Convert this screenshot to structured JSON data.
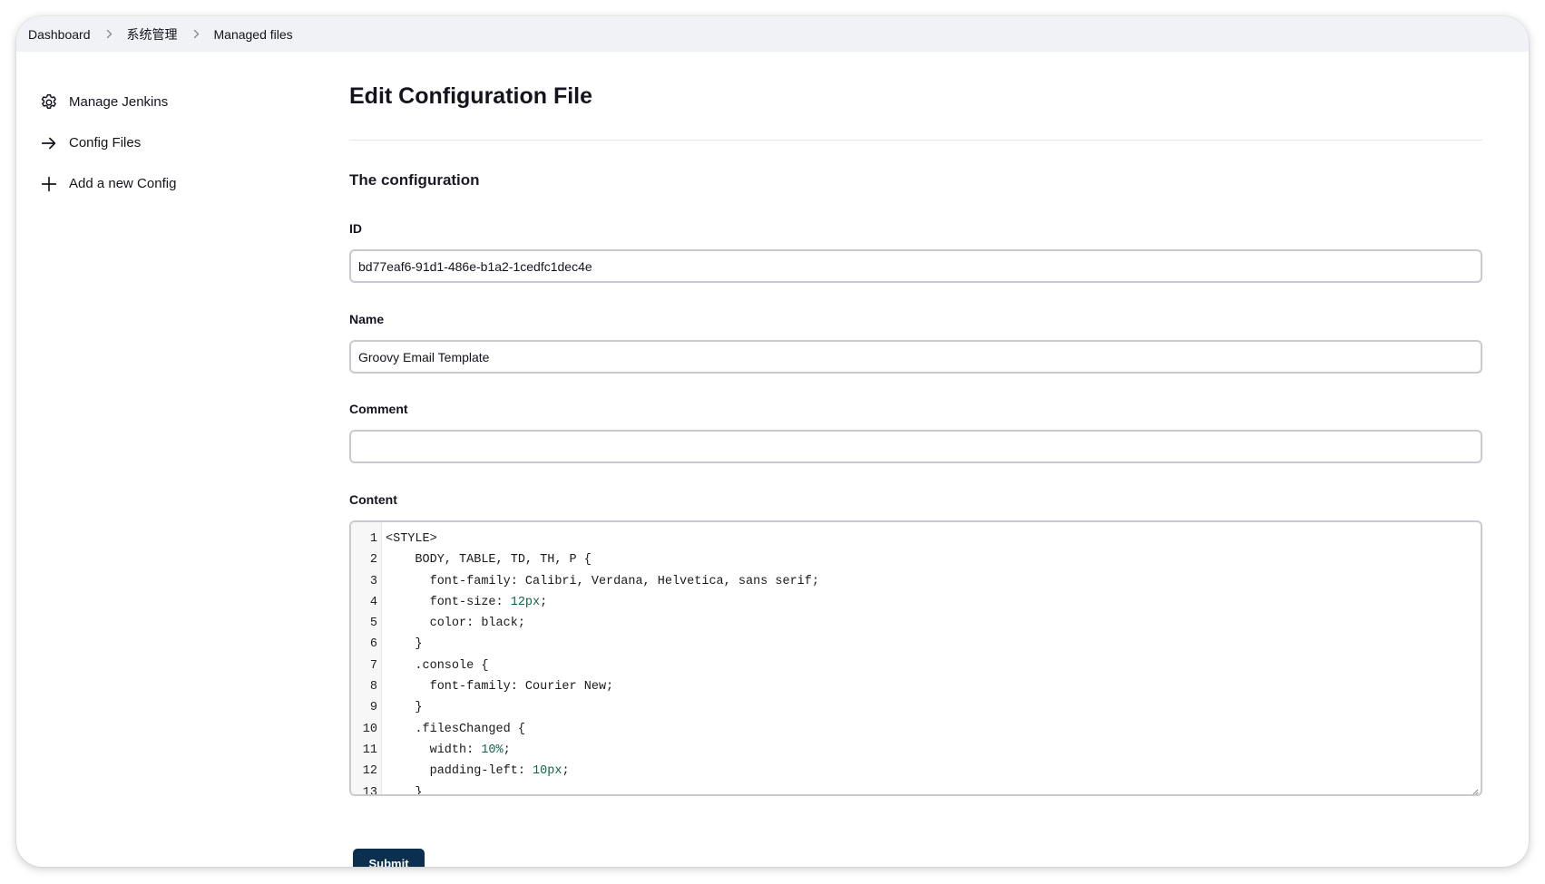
{
  "breadcrumb": {
    "items": [
      {
        "label": "Dashboard"
      },
      {
        "label": "系统管理"
      },
      {
        "label": "Managed files"
      }
    ]
  },
  "sidebar": {
    "items": [
      {
        "label": "Manage Jenkins",
        "icon": "gear-icon"
      },
      {
        "label": "Config Files",
        "icon": "arrow-right-icon"
      },
      {
        "label": "Add a new Config",
        "icon": "plus-icon"
      }
    ]
  },
  "main": {
    "title": "Edit Configuration File",
    "section_title": "The configuration",
    "fields": {
      "id": {
        "label": "ID",
        "value": "bd77eaf6-91d1-486e-b1a2-1cedfc1dec4e"
      },
      "name": {
        "label": "Name",
        "value": "Groovy Email Template"
      },
      "comment": {
        "label": "Comment",
        "value": ""
      },
      "content": {
        "label": "Content",
        "lines": [
          "<STYLE>",
          "    BODY, TABLE, TD, TH, P {",
          "      font-family: Calibri, Verdana, Helvetica, sans serif;",
          "      font-size: 12px;",
          "      color: black;",
          "    }",
          "    .console {",
          "      font-family: Courier New;",
          "    }",
          "    .filesChanged {",
          "      width: 10%;",
          "      padding-left: 10px;",
          "    }"
        ]
      }
    },
    "submit_label": "Submit"
  },
  "colors": {
    "breadcrumb_bg": "#f1f2f5",
    "submit_bg": "#0b2f4f",
    "code_number": "#116644",
    "input_border": "#c9cad0"
  }
}
